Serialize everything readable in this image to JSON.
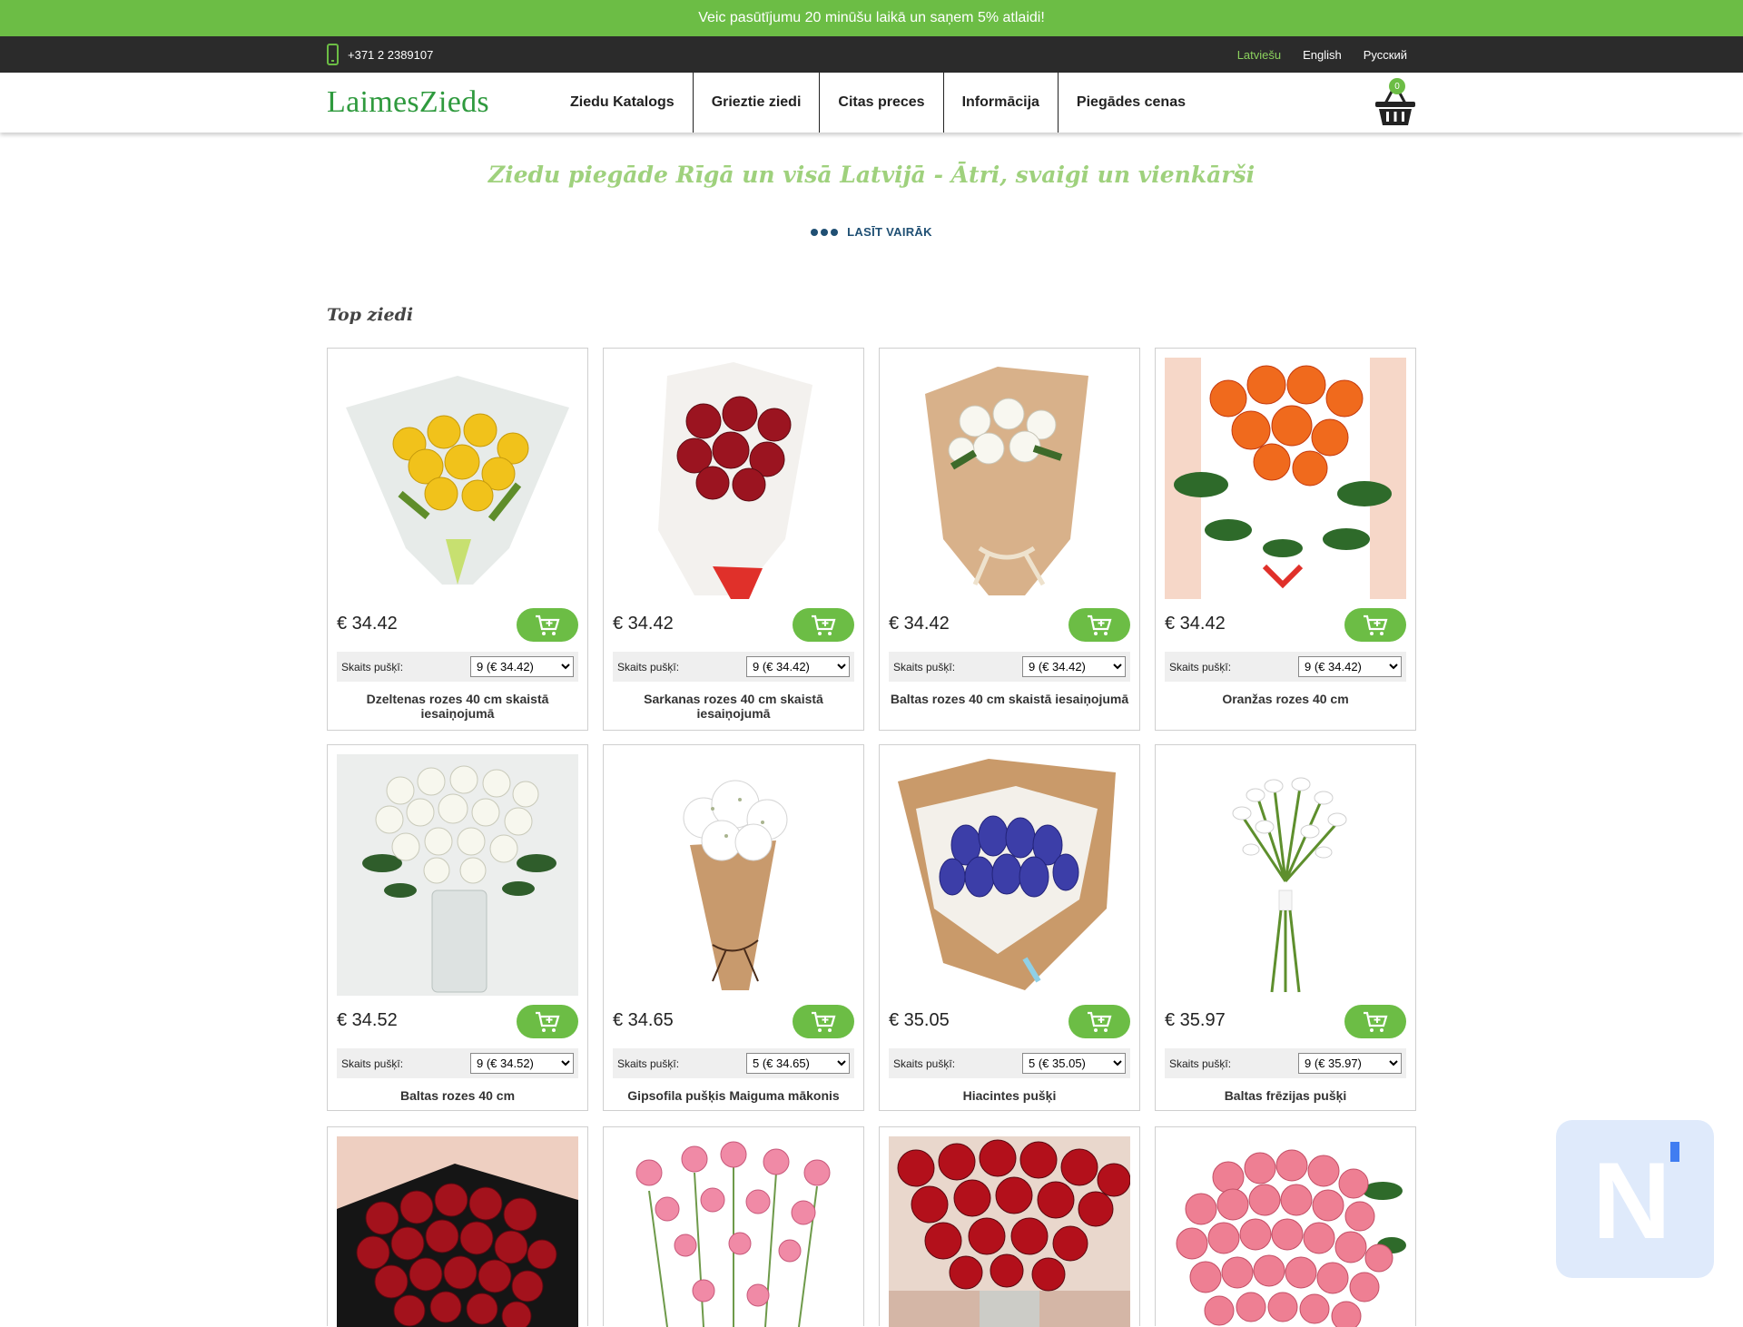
{
  "promo": {
    "text": "Veic pasūtījumu 20 minūšu laikā un saņem 5% atlaidi!"
  },
  "topbar": {
    "phone": "+371 2 2389107",
    "languages": [
      "Latviešu",
      "English",
      "Русский"
    ],
    "active_language": "Latviešu"
  },
  "header": {
    "logo": "LaimesZieds",
    "nav": [
      "Ziedu Katalogs",
      "Grieztie ziedi",
      "Citas preces",
      "Informācija",
      "Piegādes cenas"
    ],
    "cart_count": "0"
  },
  "hero": {
    "title": "Ziedu piegāde Rīgā un visā Latvijā - Ātri, svaigi un vienkārši",
    "read_more": "LASĪT VAIRĀK"
  },
  "section": {
    "title": "Top ziedi"
  },
  "products": [
    {
      "price": "€ 34.42",
      "qty_label": "Skaits pušķī:",
      "qty_value": "9 (€ 34.42)",
      "title": "Dzeltenas rozes 40 cm skaistā iesaiņojumā",
      "image": "yellow-roses-bouquet"
    },
    {
      "price": "€ 34.42",
      "qty_label": "Skaits pušķī:",
      "qty_value": "9 (€ 34.42)",
      "title": "Sarkanas rozes 40 cm skaistā iesaiņojumā",
      "image": "red-roses-bouquet"
    },
    {
      "price": "€ 34.42",
      "qty_label": "Skaits pušķī:",
      "qty_value": "9 (€ 34.42)",
      "title": "Baltas rozes 40 cm skaistā iesaiņojumā",
      "image": "white-roses-kraft-bouquet"
    },
    {
      "price": "€ 34.42",
      "qty_label": "Skaits pušķī:",
      "qty_value": "9 (€ 34.42)",
      "title": "Oranžas rozes 40 cm",
      "image": "orange-roses"
    },
    {
      "price": "€ 34.52",
      "qty_label": "Skaits pušķī:",
      "qty_value": "9 (€ 34.52)",
      "title": "Baltas rozes 40 cm",
      "image": "white-roses-vase"
    },
    {
      "price": "€ 34.65",
      "qty_label": "Skaits pušķī:",
      "qty_value": "5 (€ 34.65)",
      "title": "Gipsofila pušķis Maiguma mākonis",
      "image": "gypsophila-bouquet"
    },
    {
      "price": "€ 35.05",
      "qty_label": "Skaits pušķī:",
      "qty_value": "5 (€ 35.05)",
      "title": "Hiacintes pušķi",
      "image": "hyacinth-bouquet"
    },
    {
      "price": "€ 35.97",
      "qty_label": "Skaits pušķī:",
      "qty_value": "9 (€ 35.97)",
      "title": "Baltas frēzijas pušķi",
      "image": "white-freesia-bouquet"
    },
    {
      "image": "red-roses-black-wrap"
    },
    {
      "image": "pink-carnations"
    },
    {
      "image": "red-roses-vase"
    },
    {
      "image": "pink-roses"
    }
  ],
  "colors": {
    "brand_green": "#6cbd45",
    "topbar_dark": "#2b2b2b",
    "logo_green": "#2f9a3e",
    "hero_text": "#9fd17d"
  }
}
